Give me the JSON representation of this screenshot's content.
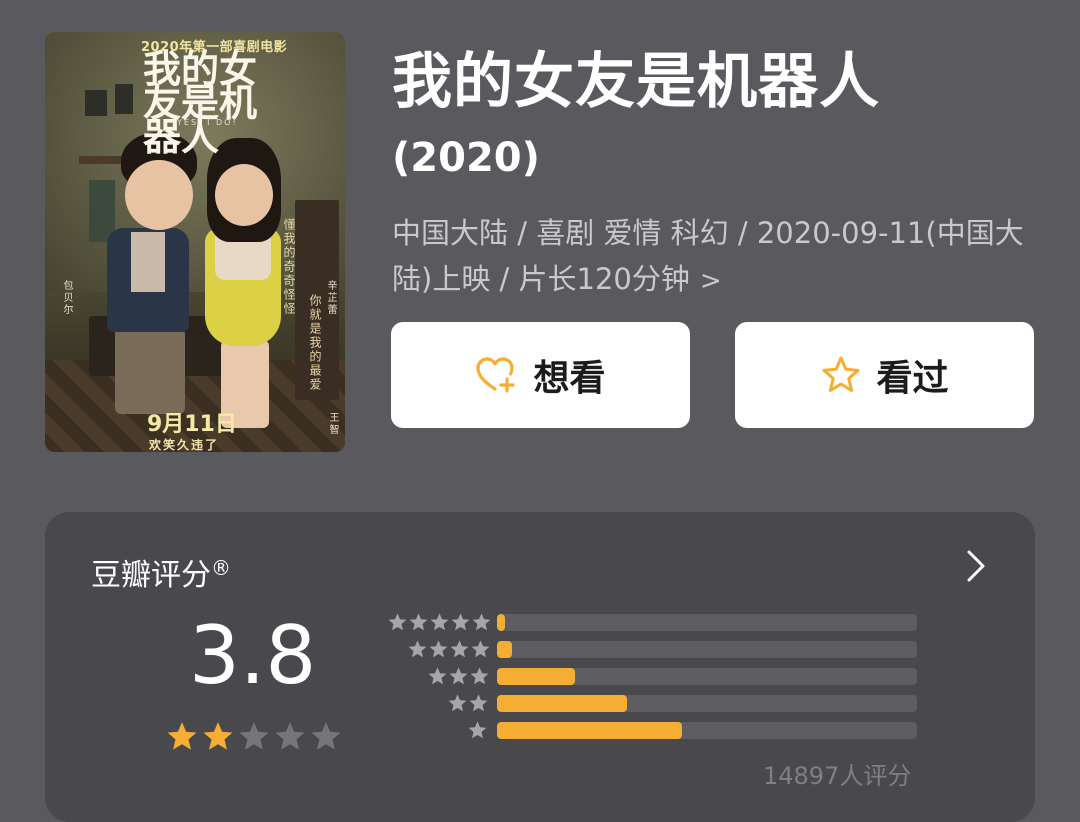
{
  "poster": {
    "top_line": "2020年第一部喜剧电影",
    "logo": "我的女友是机器人",
    "logo_en": "YES, I DO!",
    "release_date": "9月11日",
    "tagline": "欢笑久违了",
    "vertical_line_1": "懂我的奇奇怪怪",
    "vertical_line_2": "你就是我的最爱",
    "cast_1": "包贝尔",
    "cast_2": "辛芷蕾",
    "cast_3": "王智"
  },
  "movie": {
    "title": "我的女友是机器人",
    "year": "(2020)",
    "meta": "中国大陆 / 喜剧 爱情 科幻 / 2020-09-11(中国大陆)上映 / 片长120分钟",
    "meta_chevron": ">"
  },
  "actions": {
    "want_label": "想看",
    "seen_label": "看过"
  },
  "rating": {
    "title": "豆瓣评分",
    "registered_mark": "®",
    "score": "3.8",
    "score_stars_filled": 2,
    "score_stars_total": 5,
    "count_text": "14897人评分",
    "distribution": [
      {
        "stars": 5,
        "fraction": 0.02
      },
      {
        "stars": 4,
        "fraction": 0.035
      },
      {
        "stars": 3,
        "fraction": 0.185
      },
      {
        "stars": 2,
        "fraction": 0.31
      },
      {
        "stars": 1,
        "fraction": 0.44
      }
    ]
  },
  "colors": {
    "background": "#5a595e",
    "card": "#49484c",
    "accent": "#f5ae33",
    "track": "#5e5d62",
    "muted_text": "#c9c9cc"
  }
}
